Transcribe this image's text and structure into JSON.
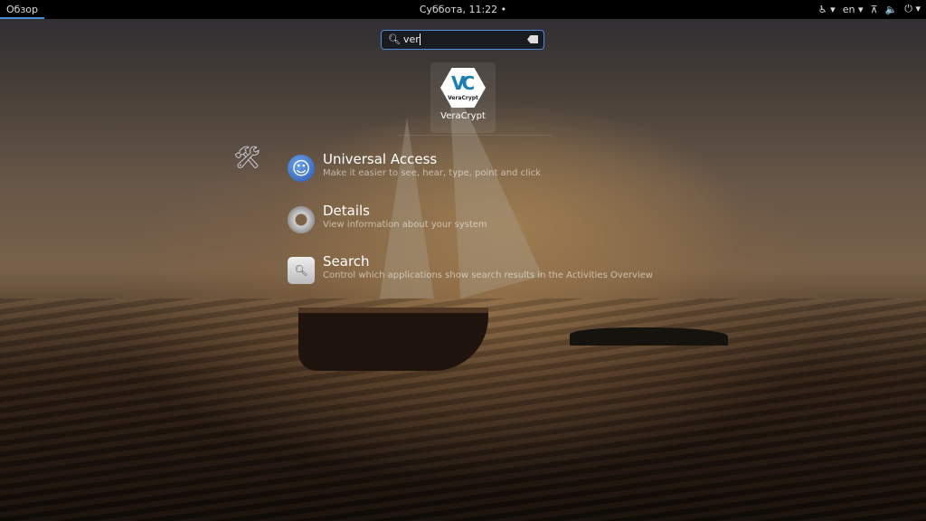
{
  "topbar": {
    "activities": "Обзор",
    "clock": "Суббота, 11:22",
    "language": "en"
  },
  "search": {
    "value": "ver"
  },
  "apps": [
    {
      "name": "VeraCrypt",
      "logo_text": "VeraCrypt"
    }
  ],
  "settings_results": [
    {
      "title": "Universal Access",
      "subtitle": "Make it easier to see, hear, type, point and click",
      "icon": "accessibility-icon"
    },
    {
      "title": "Details",
      "subtitle": "View information about your system",
      "icon": "gear-icon"
    },
    {
      "title": "Search",
      "subtitle": "Control which applications show search results in the Activities Overview",
      "icon": "search-icon"
    }
  ],
  "colors": {
    "accent": "#4a90d9"
  }
}
